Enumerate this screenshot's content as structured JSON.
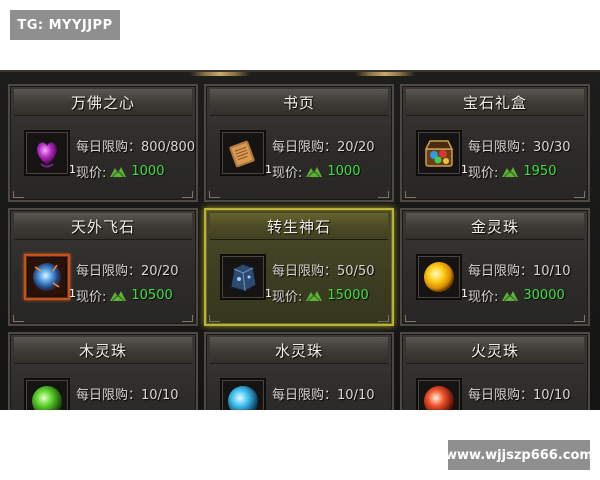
{
  "watermarks": {
    "top": "TG: MYYJJPP",
    "bottom": "www.wjjszp666.com"
  },
  "labels": {
    "limit_prefix": "每日限购：",
    "price_prefix": "现价:"
  },
  "colors": {
    "price_green": "#3fe03f",
    "selected_border": "#b9b234",
    "orange_frame": "#c5521b"
  },
  "items": [
    {
      "name": "万佛之心",
      "limit": "800/800",
      "price": "1000",
      "qty": "1",
      "icon": "purple-heart-gem-icon"
    },
    {
      "name": "书页",
      "limit": "20/20",
      "price": "1000",
      "qty": "1",
      "icon": "book-page-icon"
    },
    {
      "name": "宝石礼盒",
      "limit": "30/30",
      "price": "1950",
      "qty": "1",
      "icon": "gem-gift-box-icon"
    },
    {
      "name": "天外飞石",
      "limit": "20/20",
      "price": "10500",
      "qty": "1",
      "icon": "meteor-stone-icon"
    },
    {
      "name": "转生神石",
      "limit": "50/50",
      "price": "15000",
      "qty": "1",
      "icon": "rebirth-stone-icon",
      "selected": true
    },
    {
      "name": "金灵珠",
      "limit": "10/10",
      "price": "30000",
      "qty": "1",
      "icon": "gold-spirit-orb-icon"
    },
    {
      "name": "木灵珠",
      "limit": "10/10",
      "price": "",
      "qty": "",
      "icon": "wood-spirit-orb-icon"
    },
    {
      "name": "水灵珠",
      "limit": "10/10",
      "price": "",
      "qty": "",
      "icon": "water-spirit-orb-icon"
    },
    {
      "name": "火灵珠",
      "limit": "10/10",
      "price": "",
      "qty": "",
      "icon": "fire-spirit-orb-icon"
    }
  ]
}
